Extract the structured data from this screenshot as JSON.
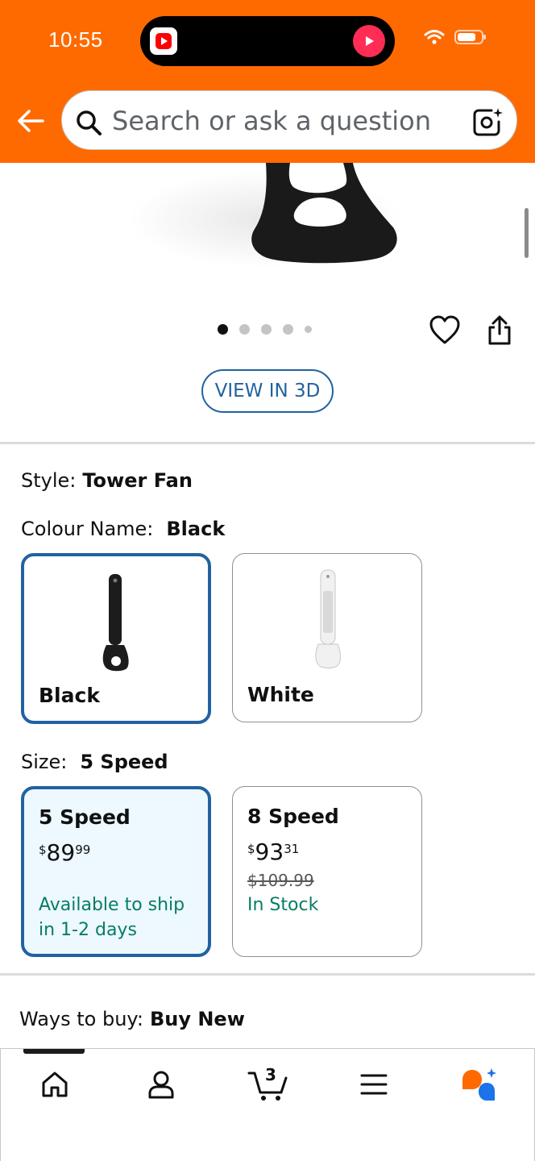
{
  "status_bar": {
    "time": "10:55"
  },
  "header": {
    "search_placeholder": "Search or ask a question"
  },
  "gallery": {
    "view_3d_label": "VIEW IN 3D",
    "image_count": 5,
    "active_index": 0
  },
  "style": {
    "label": "Style:",
    "value": "Tower Fan"
  },
  "colour": {
    "label": "Colour Name:",
    "value": "Black",
    "options": [
      {
        "name": "Black",
        "selected": true
      },
      {
        "name": "White",
        "selected": false
      }
    ]
  },
  "size": {
    "label": "Size:",
    "value": "5 Speed",
    "options": [
      {
        "name": "5 Speed",
        "price_symbol": "$",
        "price_whole": "89",
        "price_fraction": "99",
        "list_price": "",
        "availability_line1": "Available to ship",
        "availability_line2": "in 1-2 days",
        "selected": true
      },
      {
        "name": "8 Speed",
        "price_symbol": "$",
        "price_whole": "93",
        "price_fraction": "31",
        "list_price": "$109.99",
        "availability_line1": "In Stock",
        "availability_line2": "",
        "selected": false
      }
    ]
  },
  "ways_to_buy": {
    "label": "Ways to buy:",
    "value": "Buy New"
  },
  "bottom_nav": {
    "cart_count": "3",
    "items": [
      "home-icon",
      "account-icon",
      "cart-icon",
      "menu-icon",
      "rufus-icon"
    ]
  },
  "colors": {
    "header": "#ff6a00",
    "link": "#2162a1",
    "availability": "#067d62",
    "selected_tile_bg": "#edf8ff"
  }
}
